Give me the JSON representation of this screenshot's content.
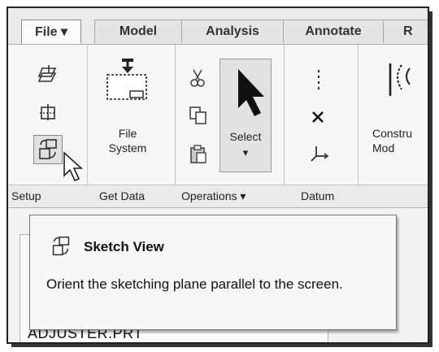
{
  "tabs": [
    {
      "label": "File ▾"
    },
    {
      "label": "Model"
    },
    {
      "label": "Analysis"
    },
    {
      "label": "Annotate"
    },
    {
      "label": "R"
    }
  ],
  "ribbon": {
    "get_data": {
      "file_system_label": "File\nSystem"
    },
    "operations": {
      "select_label": "Select",
      "select_arrow": "▾"
    },
    "model_label": "Constru\nMod"
  },
  "groups": {
    "setup": "Setup",
    "get_data": "Get Data",
    "operations": "Operations ▾",
    "datum": "Datum"
  },
  "tooltip": {
    "title": "Sketch View",
    "description": "Orient the sketching plane parallel to the screen."
  },
  "model_tree": {
    "item": "ADJUSTER.PRT"
  },
  "icons": {
    "setup_top": "sketch-setup-icon",
    "setup_mid": "reference-icon",
    "setup_bottom": "sketch-view-icon",
    "file_system": "file-system-icon",
    "cut": "scissors-icon",
    "copy": "copy-icon",
    "paste": "paste-icon",
    "select": "arrow-cursor-icon",
    "datum_axis": "datum-axis-icon",
    "datum_point": "datum-point-icon",
    "datum_csys": "coordinate-system-icon"
  }
}
